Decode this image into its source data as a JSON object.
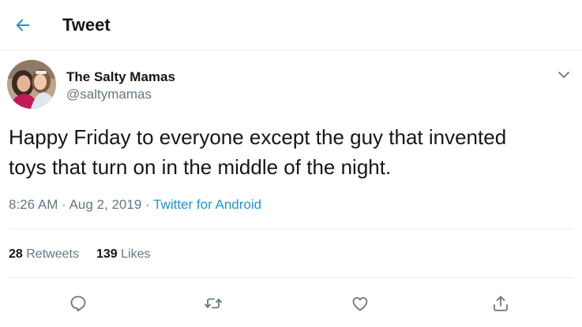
{
  "header": {
    "title": "Tweet",
    "back_icon": "back-arrow-icon"
  },
  "author": {
    "name": "The Salty Mamas",
    "handle": "@saltymamas"
  },
  "tweet": {
    "text_line1": "Happy Friday to everyone except the guy that invented",
    "text_line2": "toys that turn on in the middle of the night.",
    "time": "8:26 AM",
    "separator": "·",
    "date": "Aug 2, 2019",
    "source": "Twitter for Android"
  },
  "stats": {
    "retweets_count": "28",
    "retweets_label": "Retweets",
    "likes_count": "139",
    "likes_label": "Likes"
  },
  "actions": [
    "reply-icon",
    "retweet-icon",
    "like-icon",
    "share-icon"
  ],
  "colors": {
    "accent": "#1b95e0",
    "secondary_text": "#657786",
    "divider": "#e6ecf0"
  }
}
